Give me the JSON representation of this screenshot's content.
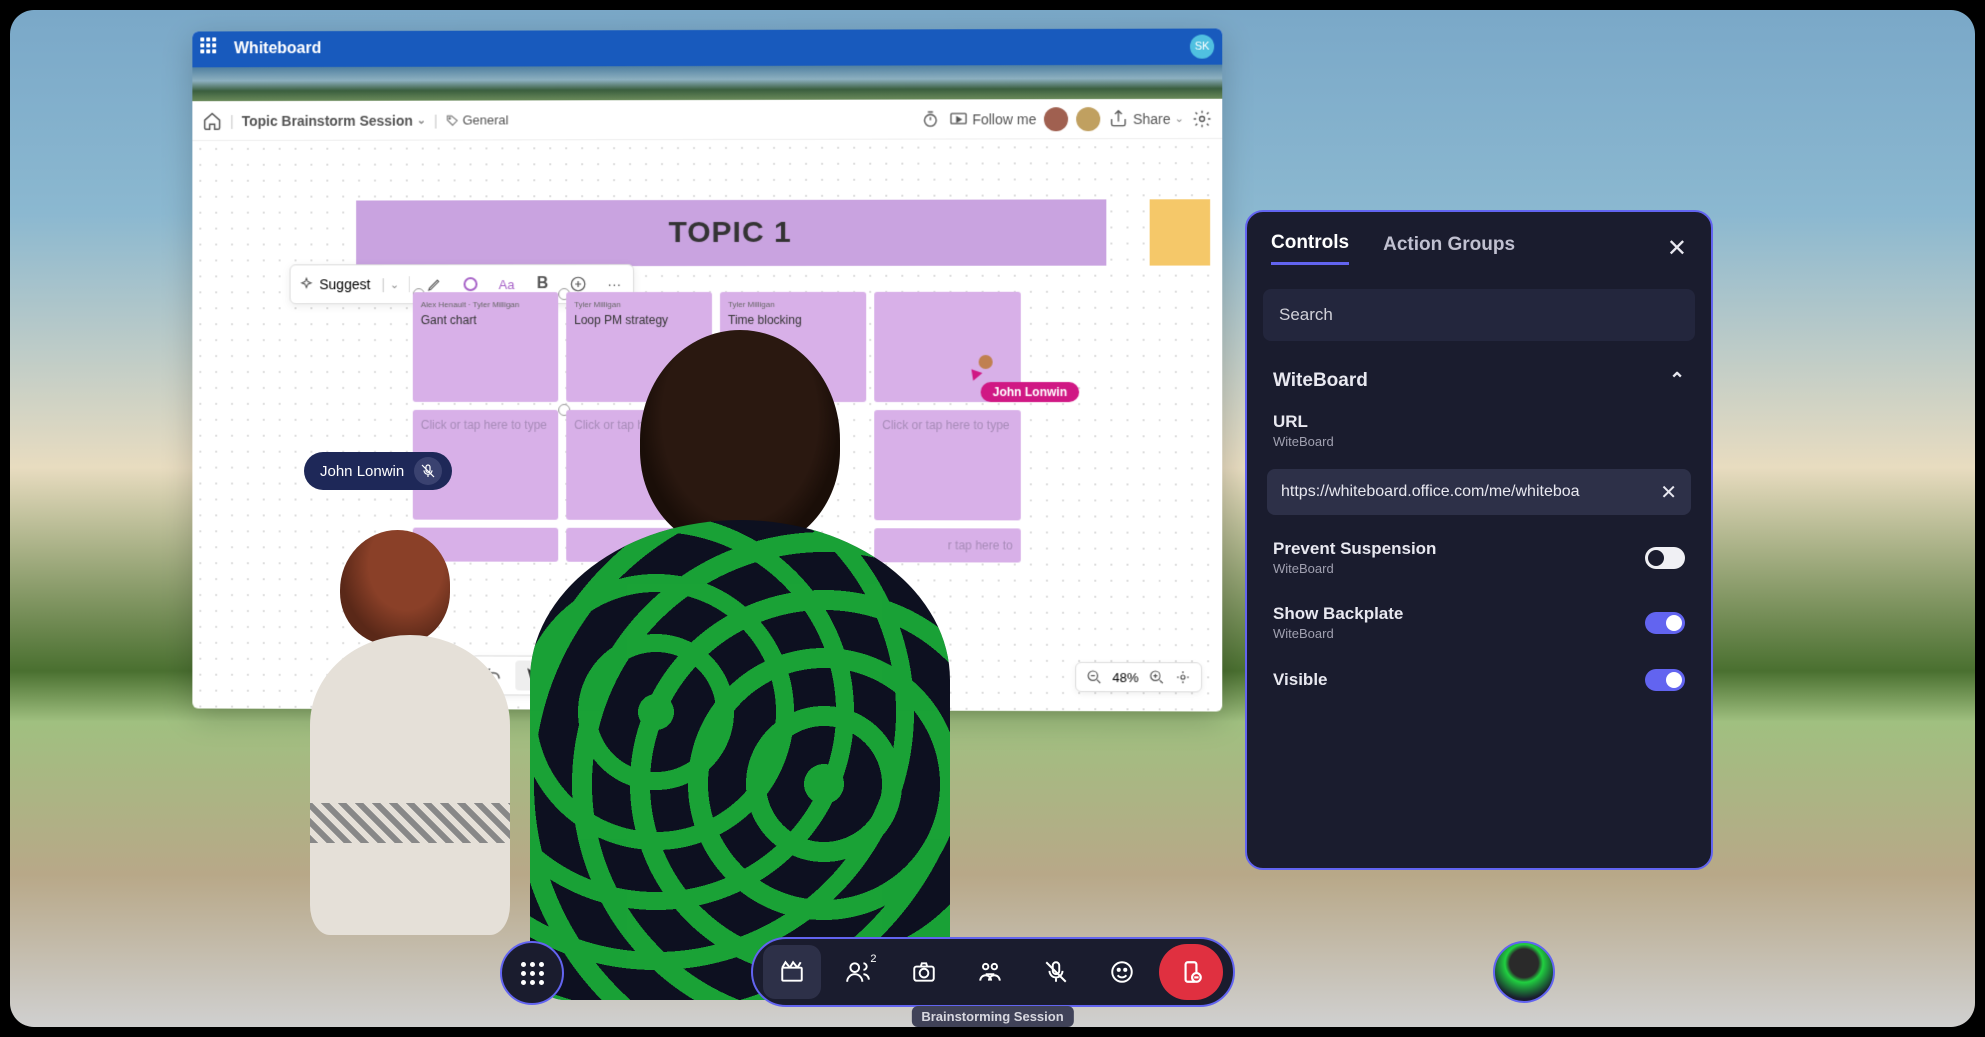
{
  "whiteboard": {
    "app_title": "Whiteboard",
    "user_initials": "SK",
    "file_name": "Topic Brainstorm Session",
    "tag_label": "General",
    "follow_label": "Follow me",
    "share_label": "Share",
    "topic_title": "TOPIC 1",
    "suggest_label": "Suggest",
    "bold_label": "B",
    "aa_label": "Aa",
    "more_label": "···",
    "zoom_value": "48%",
    "stickies": [
      {
        "author": "Alex Henault · Tyler Milligan",
        "text": "Gant chart"
      },
      {
        "author": "Tyler Milligan",
        "text": "Loop PM strategy"
      },
      {
        "author": "Tyler Milligan",
        "text": "Time blocking"
      },
      {
        "author": "",
        "text": ""
      }
    ],
    "placeholder_text": "Click or tap here to type",
    "cursor_user": "John Lonwin"
  },
  "user_label": {
    "name": "John Lonwin"
  },
  "controls": {
    "tabs": {
      "controls": "Controls",
      "action_groups": "Action Groups"
    },
    "search_placeholder": "Search",
    "section_title": "WiteBoard",
    "url_prop": {
      "label": "URL",
      "sub": "WiteBoard",
      "value": "https://whiteboard.office.com/me/whiteboa"
    },
    "prevent": {
      "label": "Prevent Suspension",
      "sub": "WiteBoard"
    },
    "backplate": {
      "label": "Show Backplate",
      "sub": "WiteBoard"
    },
    "visible": {
      "label": "Visible"
    }
  },
  "dock": {
    "session_label": "Brainstorming Session",
    "people_count": "2"
  }
}
